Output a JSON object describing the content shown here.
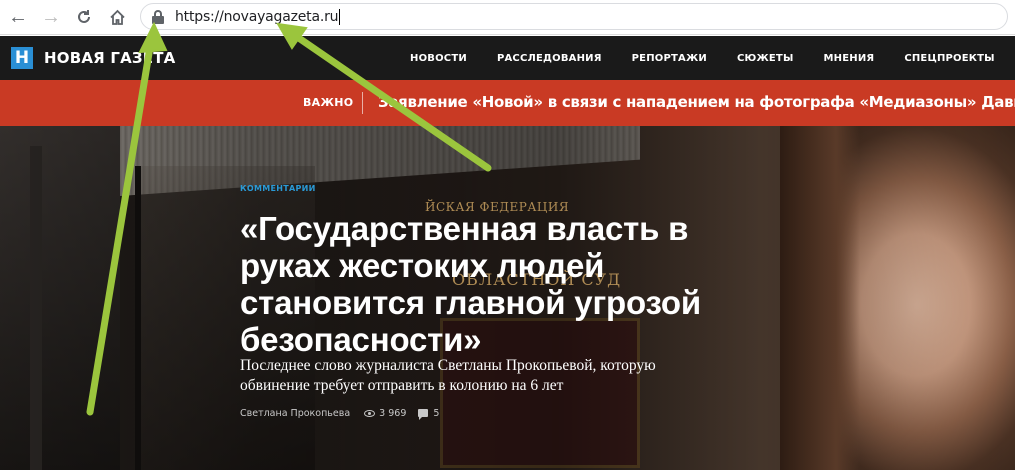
{
  "browser": {
    "back_icon": "arrow-left-icon",
    "forward_icon": "arrow-right-icon",
    "reload_icon": "reload-icon",
    "home_icon": "home-icon",
    "lock_icon": "lock-icon",
    "url": "https://novayagazeta.ru"
  },
  "site": {
    "logo_letter": "Н",
    "logo_text": "НОВАЯ ГАЗЕТА",
    "brand_color": "#2a8fd5",
    "menu": [
      {
        "label": "НОВОСТИ"
      },
      {
        "label": "РАССЛЕДОВАНИЯ"
      },
      {
        "label": "РЕПОРТАЖИ"
      },
      {
        "label": "СЮЖЕТЫ"
      },
      {
        "label": "МНЕНИЯ"
      },
      {
        "label": "СПЕЦПРОЕКТЫ"
      }
    ]
  },
  "alert": {
    "label": "ВАЖНО",
    "text": "Заявление «Новой» в связи с нападением на фотографа «Медиазоны» Давида Френкеля",
    "color": "#c93a24"
  },
  "hero": {
    "category": "КОММЕНТАРИИ",
    "headline_lines": [
      "«Государственная власть в",
      "руках жестоких людей",
      "становится главной угрозой",
      "безопасности»"
    ],
    "lead": "Последнее слово журналиста Светланы Прокопьевой, которую обвинение требует отправить в колонию на 6 лет",
    "author": "Светлана Прокопьева",
    "views": "3 969",
    "comments": "5",
    "plaque_line1": "ЙСКАЯ ФЕДЕРАЦИЯ",
    "plaque_line2": "ОБЛАСТНОЙ СУД"
  },
  "annotation": {
    "arrow_color": "#9bc53d"
  }
}
